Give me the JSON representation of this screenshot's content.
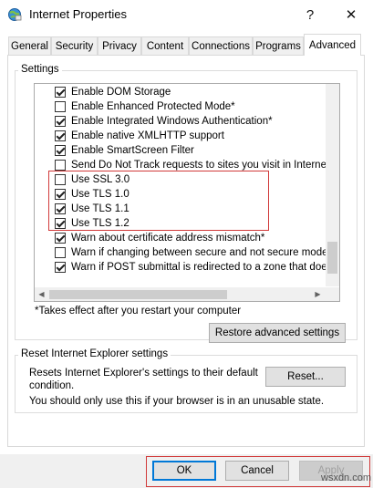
{
  "window": {
    "title": "Internet Properties",
    "help_label": "?",
    "close_label": "✕"
  },
  "tabs": [
    {
      "label": "General"
    },
    {
      "label": "Security"
    },
    {
      "label": "Privacy"
    },
    {
      "label": "Content"
    },
    {
      "label": "Connections"
    },
    {
      "label": "Programs"
    },
    {
      "label": "Advanced"
    }
  ],
  "settings": {
    "group_label": "Settings",
    "items": [
      {
        "label": "Enable DOM Storage",
        "checked": true
      },
      {
        "label": "Enable Enhanced Protected Mode*",
        "checked": false
      },
      {
        "label": "Enable Integrated Windows Authentication*",
        "checked": true
      },
      {
        "label": "Enable native XMLHTTP support",
        "checked": true
      },
      {
        "label": "Enable SmartScreen Filter",
        "checked": true
      },
      {
        "label": "Send Do Not Track requests to sites you visit in Internet E",
        "checked": false
      },
      {
        "label": "Use SSL 3.0",
        "checked": false
      },
      {
        "label": "Use TLS 1.0",
        "checked": true
      },
      {
        "label": "Use TLS 1.1",
        "checked": true
      },
      {
        "label": "Use TLS 1.2",
        "checked": true
      },
      {
        "label": "Warn about certificate address mismatch*",
        "checked": true
      },
      {
        "label": "Warn if changing between secure and not secure mode",
        "checked": false
      },
      {
        "label": "Warn if POST submittal is redirected to a zone that does n",
        "checked": true
      }
    ],
    "footnote": "*Takes effect after you restart your computer",
    "restore_label": "Restore advanced settings"
  },
  "reset": {
    "group_label": "Reset Internet Explorer settings",
    "description": "Resets Internet Explorer's settings to their default condition.",
    "reset_label": "Reset...",
    "note": "You should only use this if your browser is in an unusable state."
  },
  "footer": {
    "ok_label": "OK",
    "cancel_label": "Cancel",
    "apply_label": "Apply",
    "watermark": "wsxdn.com"
  }
}
